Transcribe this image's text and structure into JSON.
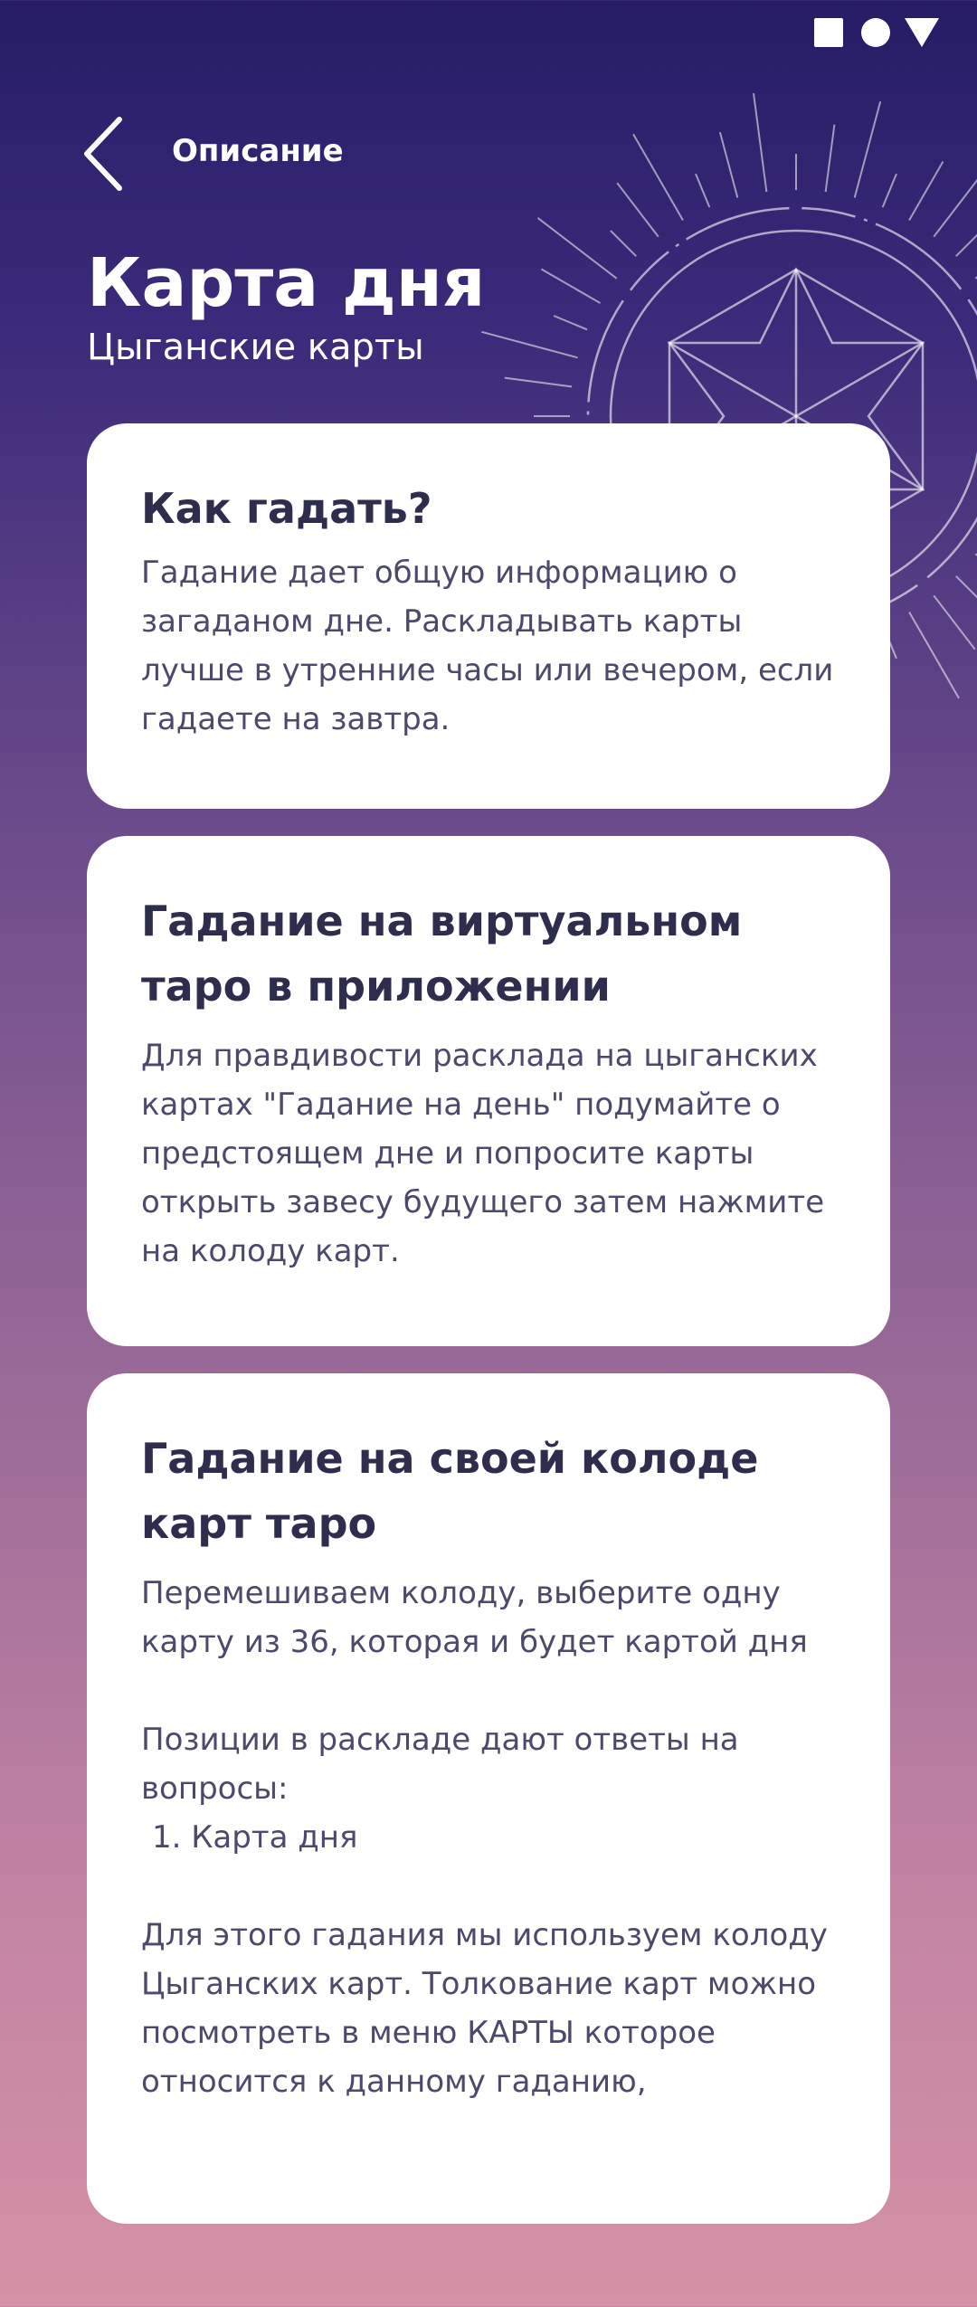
{
  "header": {
    "back_label": "Описание",
    "title": "Карта дня",
    "subtitle": "Цыганские карты"
  },
  "icons": {
    "back": "chevron-left-icon",
    "status_square": "square-icon",
    "status_circle": "circle-icon",
    "status_triangle": "triangle-icon",
    "decoration": "mandala-icon"
  },
  "colors": {
    "background_top": "#261d66",
    "background_bottom": "#d592a6",
    "card": "#ffffff",
    "title_text": "#2e2d4d",
    "body_text": "#4b4a6c"
  },
  "cards": [
    {
      "title": "Как гадать?",
      "text": "Гадание дает общую информацию о загаданом дне. Раскладывать карты лучше в утренние часы или вечером, если гадаете на завтра."
    },
    {
      "title": "Гадание на виртуальном таро в приложении",
      "text": "Для правдивости расклада на цыганских картах \"Гадание на день\" подумайте о предстоящем дне и попросите карты открыть завесу будущего затем нажмите на колоду карт."
    },
    {
      "title": "Гадание на своей колоде карт таро",
      "text": "Перемешиваем колоду, выберите одну карту из 36, которая и будет картой дня",
      "positions_intro": "Позиции в раскладе дают ответы на вопросы:",
      "positions": [
        "1. Карта дня"
      ],
      "text_extra": "Для этого гадания мы используем колоду Цыганских карт. Толкование карт можно посмотреть в меню КАРТЫ которое относится к данному гаданию,"
    }
  ]
}
